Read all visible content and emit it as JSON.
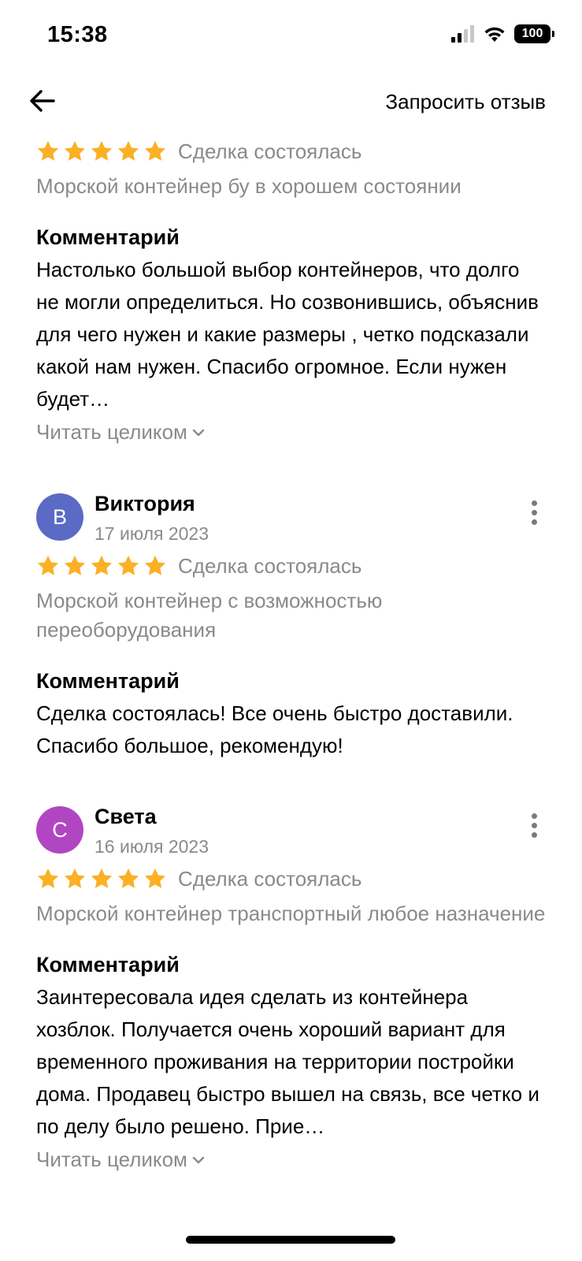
{
  "status_bar": {
    "time": "15:38",
    "battery": "100"
  },
  "nav": {
    "request_review_label": "Запросить отзыв"
  },
  "reviews": [
    {
      "rating": 5,
      "deal_status": "Сделка состоялась",
      "item_title": "Морской контейнер бу в хорошем состоянии",
      "comment_heading": "Комментарий",
      "comment": "Настолько большой выбор контейнеров, что долго не могли определиться. Но созвонившись, объяснив для чего нужен и какие размеры , четко подсказали какой нам нужен. Спасибо огромное. Если нужен будет…",
      "read_more": "Читать целиком"
    },
    {
      "avatar_letter": "В",
      "avatar_color": "#5b6ac4",
      "name": "Виктория",
      "date": "17 июля 2023",
      "rating": 5,
      "deal_status": "Сделка состоялась",
      "item_title": "Морской контейнер с возможностью переоборудования",
      "comment_heading": "Комментарий",
      "comment": "Сделка состоялась! Все очень быстро доставили. Спасибо большое, рекомендую!"
    },
    {
      "avatar_letter": "С",
      "avatar_color": "#b146c2",
      "name": "Света",
      "date": "16 июля 2023",
      "rating": 5,
      "deal_status": "Сделка состоялась",
      "item_title": "Морской контейнер транспортный любое назначение",
      "comment_heading": "Комментарий",
      "comment": "Заинтересовала идея сделать из контейнера хозблок. Получается очень хороший вариант для временного проживания на территории постройки дома. Продавец быстро вышел на связь, все четко и по делу было решено. Прие…",
      "read_more": "Читать целиком"
    }
  ],
  "colors": {
    "star": "#fbb025",
    "secondary_text": "#8a8a8a"
  },
  "icons": [
    "back-arrow-icon",
    "star-icon",
    "more-vertical-icon",
    "chevron-down-icon",
    "signal-icon",
    "wifi-icon",
    "battery-icon"
  ]
}
